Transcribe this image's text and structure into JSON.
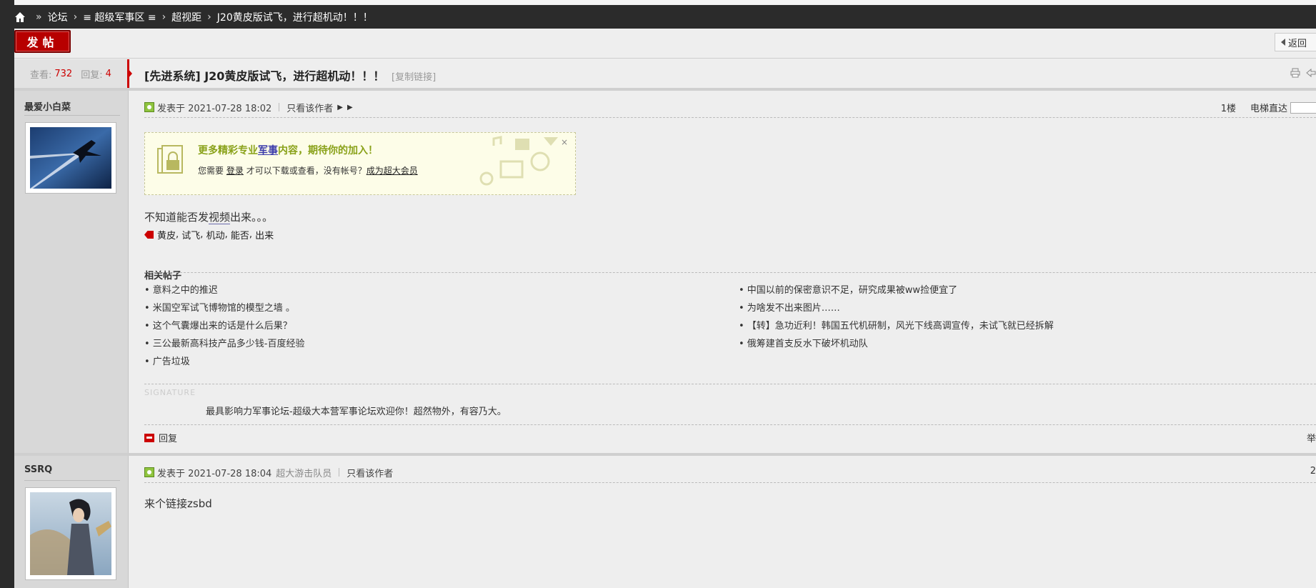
{
  "breadcrumb": {
    "items": [
      "论坛",
      "≡ 超级军事区 ≡",
      "超视距",
      "J20黄皮版试飞，进行超机动！！！"
    ]
  },
  "toolbar": {
    "post_label": "发帖",
    "back_label": "返回"
  },
  "thread": {
    "views_label": "查看:",
    "views": "732",
    "replies_label": "回复:",
    "replies": "4",
    "title": "[先进系统] J20黄皮版试飞，进行超机动！！！",
    "copy_link": "[复制链接]"
  },
  "posts": [
    {
      "author": "最爱小白菜",
      "posted_at": "发表于 2021-07-28 18:02",
      "only_author": "只看该作者",
      "floor": "1楼",
      "elevator": "电梯直达",
      "promo": {
        "headline_pre": "更多精彩专业",
        "headline_link": "军事",
        "headline_post": "内容，期待你的加入！",
        "sub_pre": "您需要",
        "login": "登录",
        "sub_mid": "才可以下载或查看，没有帐号？",
        "register": "成为超大会员",
        "close": "×"
      },
      "content_pre": "不知道能否发",
      "content_link": "视频",
      "content_post": "出来。。。",
      "tags": [
        "黄皮",
        "试飞",
        "机动",
        "能否",
        "出来"
      ],
      "related_title": "相关帖子",
      "related_left": [
        "• 意料之中的推迟",
        "• 米国空军试飞博物馆的模型之墙 。",
        "• 这个气囊爆出来的话是什么后果？",
        "• 三公最新高科技产品多少钱-百度经验",
        "• 广告垃圾"
      ],
      "related_right": [
        "• 中国以前的保密意识不足，研究成果被ww捡便宜了",
        "• 为啥发不出来图片……",
        "• 【转】急功近利！韩国五代机研制，风光下线高调宣传，未试飞就已经拆解",
        "• 俄筹建首支反水下破坏机动队"
      ],
      "signature_label": "SIGNATURE",
      "signature": "最具影响力军事论坛-超级大本营军事论坛欢迎你！超然物外，有容乃大。",
      "reply": "回复",
      "report": "举"
    },
    {
      "author": "SSRQ",
      "posted_at": "发表于 2021-07-28 18:04",
      "group": "超大游击队员",
      "only_author": "只看该作者",
      "floor": "2",
      "content": "来个链接zsbd"
    }
  ],
  "colors": {
    "accent": "#c00000",
    "promo_bg": "#fdfde8",
    "sidebar_bg": "#d8d8d8",
    "page_bg": "#eeeeee"
  }
}
